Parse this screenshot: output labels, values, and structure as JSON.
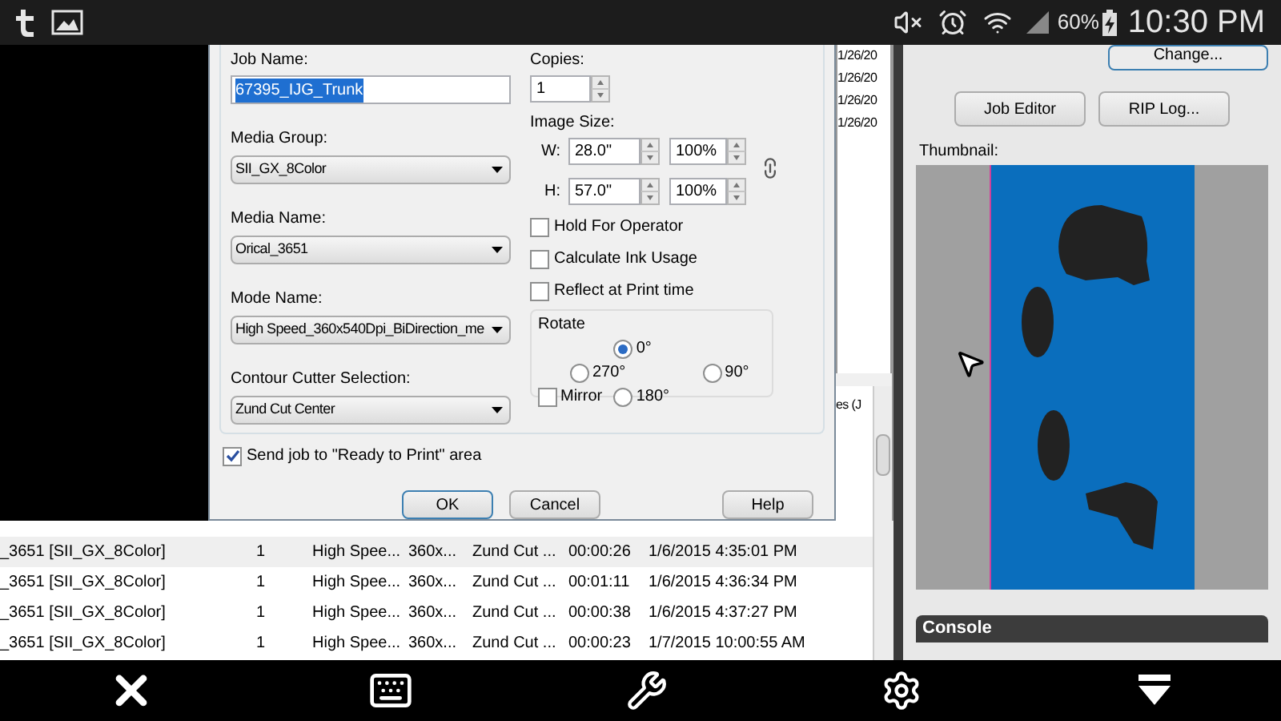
{
  "status_bar": {
    "battery": "60%",
    "time": "10:30 PM"
  },
  "dialog": {
    "job_name": {
      "label": "Job Name:",
      "value": "67395_IJG_Trunk"
    },
    "selects": [
      {
        "label": "Media Group:",
        "value": "SII_GX_8Color"
      },
      {
        "label": "Media Name:",
        "value": "Orical_3651"
      },
      {
        "label": "Mode Name:",
        "value": "High Speed_360x540Dpi_BiDirection_me"
      },
      {
        "label": "Contour Cutter Selection:",
        "value": "Zund Cut Center"
      }
    ],
    "copies": {
      "label": "Copies:",
      "value": "1"
    },
    "image_size": {
      "label": "Image Size:",
      "rows": [
        {
          "label": "W:",
          "value": "28.0\"",
          "percent": "100%"
        },
        {
          "label": "H:",
          "value": "57.0\"",
          "percent": "100%"
        }
      ]
    },
    "options": [
      {
        "label": "Hold For Operator",
        "checked": false
      },
      {
        "label": "Calculate Ink Usage",
        "checked": false
      },
      {
        "label": "Reflect at Print time",
        "checked": false
      }
    ],
    "rotate": {
      "label": "Rotate",
      "options": [
        {
          "label": "0°",
          "selected": true
        },
        {
          "label": "270°",
          "selected": false
        },
        {
          "label": "90°",
          "selected": false
        },
        {
          "label": "180°",
          "selected": false
        }
      ],
      "mirror": {
        "label": "Mirror",
        "checked": false
      }
    },
    "send_ready": {
      "label": "Send job to \"Ready to Print\" area",
      "checked": true
    },
    "buttons": [
      "OK",
      "Cancel",
      "Help"
    ]
  },
  "side_list": {
    "dates": [
      "1/26/20",
      "1/26/20",
      "1/26/20",
      "1/26/20"
    ],
    "header": "es (J"
  },
  "right_panel": {
    "change_button": "Change...",
    "buttons": [
      "Job Editor",
      "RIP Log..."
    ],
    "thumbnail_label": "Thumbnail:",
    "console": "Console"
  },
  "job_table": {
    "rows": [
      {
        "selected": true,
        "cells": [
          "_3651 [SII_GX_8Color]",
          "1",
          "High Spee...",
          "360x...",
          "Zund Cut ...",
          "00:00:26",
          "1/6/2015 4:35:01 PM"
        ]
      },
      {
        "selected": false,
        "cells": [
          "_3651 [SII_GX_8Color]",
          "1",
          "High Spee...",
          "360x...",
          "Zund Cut ...",
          "00:01:11",
          "1/6/2015 4:36:34 PM"
        ]
      },
      {
        "selected": false,
        "cells": [
          "_3651 [SII_GX_8Color]",
          "1",
          "High Spee...",
          "360x...",
          "Zund Cut ...",
          "00:00:38",
          "1/6/2015 4:37:27 PM"
        ]
      },
      {
        "selected": false,
        "cells": [
          "_3651 [SII_GX_8Color]",
          "1",
          "High Spee...",
          "360x...",
          "Zund Cut ...",
          "00:00:23",
          "1/7/2015 10:00:55 AM"
        ]
      }
    ]
  }
}
